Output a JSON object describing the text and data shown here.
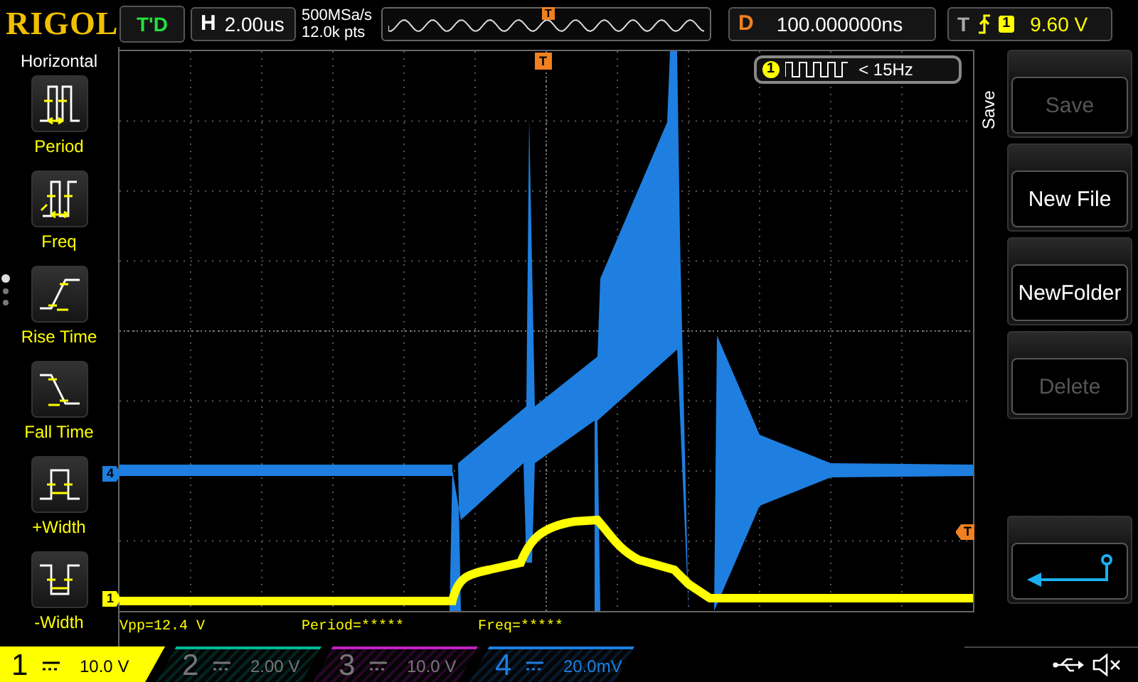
{
  "top_bar": {
    "logo": "RIGOL",
    "run_status": "T'D",
    "timebase": {
      "label": "H",
      "value": "2.00us"
    },
    "sample_rate": "500MSa/s",
    "memory_depth": "12.0k pts",
    "overview_marker": "T",
    "delay": {
      "label": "D",
      "value": "100.000000ns"
    },
    "trigger": {
      "label": "T",
      "channel": "1",
      "level": "9.60 V"
    }
  },
  "measure_menu": {
    "title": "Horizontal",
    "items": [
      {
        "label": "Period",
        "kind": "period"
      },
      {
        "label": "Freq",
        "kind": "freq"
      },
      {
        "label": "Rise Time",
        "kind": "rise"
      },
      {
        "label": "Fall Time",
        "kind": "fall"
      },
      {
        "label": "+Width",
        "kind": "pwidth"
      },
      {
        "label": "-Width",
        "kind": "nwidth"
      }
    ],
    "pages": [
      {
        "selected": true
      },
      {
        "selected": false
      },
      {
        "selected": false
      }
    ]
  },
  "plot": {
    "trigger_marker_top": "T",
    "trigger_marker_right": "T",
    "channel_markers": [
      {
        "label": "4",
        "color": "#1e7fe0"
      },
      {
        "label": "1",
        "color": "#ffff00"
      }
    ],
    "frequency_badge": {
      "channel": "1",
      "text": "< 15Hz"
    }
  },
  "measurements": [
    "Vpp=12.4 V",
    "Period=*****",
    "Freq=*****"
  ],
  "save_menu": {
    "title": "Save",
    "buttons": [
      {
        "kind": "text",
        "label": "Save",
        "disabled": true
      },
      {
        "kind": "text",
        "label": "New File",
        "disabled": false
      },
      {
        "kind": "text",
        "label": "NewFolder",
        "disabled": false
      },
      {
        "kind": "text",
        "label": "Delete",
        "disabled": true
      },
      {
        "kind": "back",
        "disabled": false
      }
    ]
  },
  "channels": [
    {
      "label": "1",
      "scale": "10.0 V",
      "on": true,
      "selected": true,
      "color": "#ffff00"
    },
    {
      "label": "2",
      "scale": "2.00 V",
      "on": false,
      "selected": false,
      "color": "#00b894"
    },
    {
      "label": "3",
      "scale": "10.0 V",
      "on": false,
      "selected": false,
      "color": "#c020c0"
    },
    {
      "label": "4",
      "scale": "20.0mV",
      "on": true,
      "selected": false,
      "color": "#1e7fe0"
    }
  ]
}
